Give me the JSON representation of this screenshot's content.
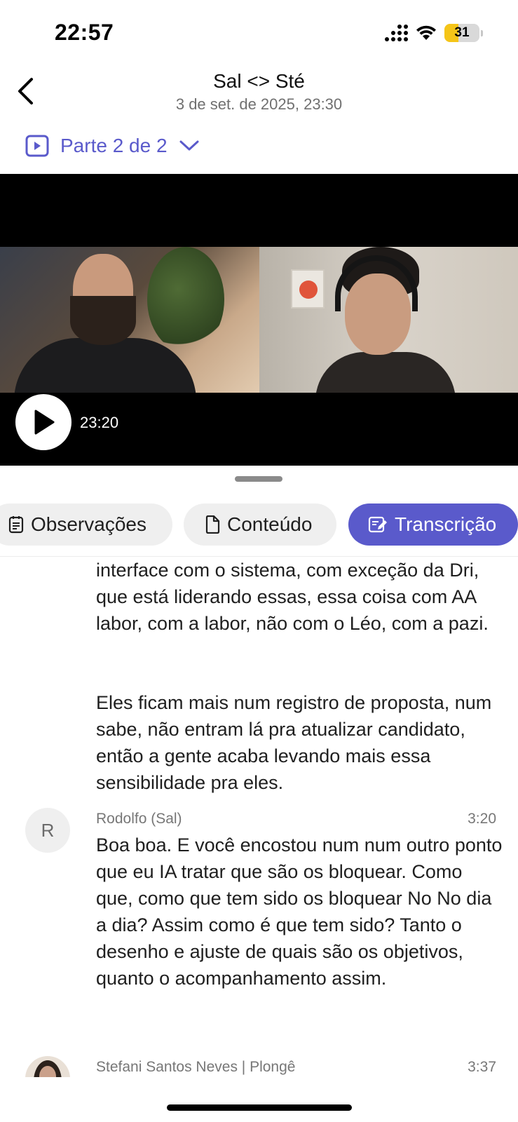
{
  "status_bar": {
    "time": "22:57",
    "battery_level": "31",
    "battery_color": "#f5c518"
  },
  "header": {
    "title": "Sal <> Sté",
    "subtitle": "3 de set. de 2025, 23:30",
    "part_label": "Parte 2 de 2"
  },
  "video": {
    "current_time": "23:20"
  },
  "tabs": [
    {
      "label": "Observações",
      "icon": "notes-icon",
      "active": false
    },
    {
      "label": "Conteúdo",
      "icon": "document-icon",
      "active": false
    },
    {
      "label": "Transcrição",
      "icon": "edit-document-icon",
      "active": true
    }
  ],
  "accent_color": "#5a5acb",
  "transcript": {
    "continued_paragraphs": [
      "interface com o sistema, com exceção da Dri, que está liderando essas, essa coisa com AA labor, com a labor, não com o Léo, com a pazi.",
      "Eles ficam mais num registro de proposta, num sabe, não entram lá pra atualizar candidato, então a gente acaba levando mais essa sensibilidade pra eles."
    ],
    "entries": [
      {
        "avatar_initial": "R",
        "speaker": "Rodolfo (Sal)",
        "timestamp": "3:20",
        "text": "Boa boa. E você encostou num num outro ponto que eu IA tratar que são os bloquear. Como que, como que tem sido os bloquear No No dia a dia? Assim como é que tem sido? Tanto o desenho e ajuste de quais são os objetivos, quanto o acompanhamento assim."
      },
      {
        "avatar_initial": "",
        "speaker": "Stefani Santos Neves | Plongê",
        "timestamp": "3:37",
        "text": ""
      }
    ]
  }
}
